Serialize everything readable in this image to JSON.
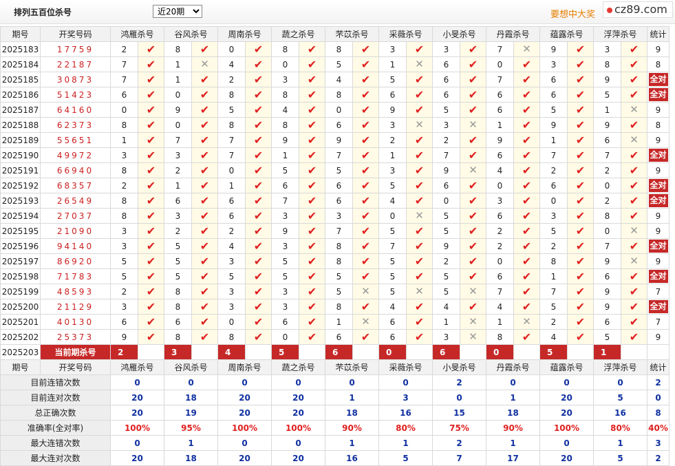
{
  "header": {
    "title": "排列五百位杀号",
    "period_select": "近20期",
    "promo_text": "要想中大奖",
    "logo_text": "cz89.com"
  },
  "columns": {
    "issue": "期号",
    "code": "开奖号码",
    "experts": [
      "鸿雁杀号",
      "谷风杀号",
      "周南杀号",
      "蔬之杀号",
      "芣苡杀号",
      "采薇杀号",
      "小旻杀号",
      "丹霞杀号",
      "蕴露杀号",
      "浮萍杀号"
    ],
    "stat": "统计"
  },
  "rows": [
    {
      "issue": "2025183",
      "code": "17759",
      "kill": [
        "2",
        "8",
        "0",
        "8",
        "8",
        "3",
        "3",
        "7",
        "9",
        "3"
      ],
      "ok": [
        1,
        1,
        1,
        1,
        1,
        1,
        1,
        0,
        1,
        1
      ],
      "count": "9"
    },
    {
      "issue": "2025184",
      "code": "22187",
      "kill": [
        "7",
        "1",
        "4",
        "0",
        "5",
        "1",
        "6",
        "0",
        "3",
        "8"
      ],
      "ok": [
        1,
        0,
        1,
        1,
        1,
        0,
        1,
        1,
        1,
        1
      ],
      "count": "8"
    },
    {
      "issue": "2025185",
      "code": "30873",
      "kill": [
        "7",
        "1",
        "2",
        "3",
        "4",
        "5",
        "6",
        "7",
        "6",
        "9"
      ],
      "ok": [
        1,
        1,
        1,
        1,
        1,
        1,
        1,
        1,
        1,
        1
      ],
      "count": "全对"
    },
    {
      "issue": "2025186",
      "code": "51423",
      "kill": [
        "6",
        "0",
        "8",
        "8",
        "8",
        "6",
        "6",
        "6",
        "6",
        "5"
      ],
      "ok": [
        1,
        1,
        1,
        1,
        1,
        1,
        1,
        1,
        1,
        1
      ],
      "count": "全对"
    },
    {
      "issue": "2025187",
      "code": "64160",
      "kill": [
        "0",
        "9",
        "5",
        "4",
        "0",
        "9",
        "5",
        "6",
        "5",
        "1"
      ],
      "ok": [
        1,
        1,
        1,
        1,
        1,
        1,
        1,
        1,
        1,
        0
      ],
      "count": "9"
    },
    {
      "issue": "2025188",
      "code": "62373",
      "kill": [
        "8",
        "0",
        "8",
        "8",
        "6",
        "3",
        "3",
        "1",
        "9",
        "9"
      ],
      "ok": [
        1,
        1,
        1,
        1,
        1,
        0,
        0,
        1,
        1,
        1
      ],
      "count": "8"
    },
    {
      "issue": "2025189",
      "code": "55651",
      "kill": [
        "1",
        "7",
        "7",
        "9",
        "9",
        "2",
        "2",
        "9",
        "1",
        "6"
      ],
      "ok": [
        1,
        1,
        1,
        1,
        1,
        1,
        1,
        1,
        1,
        0
      ],
      "count": "9"
    },
    {
      "issue": "2025190",
      "code": "49972",
      "kill": [
        "3",
        "3",
        "7",
        "1",
        "7",
        "1",
        "7",
        "6",
        "7",
        "7"
      ],
      "ok": [
        1,
        1,
        1,
        1,
        1,
        1,
        1,
        1,
        1,
        1
      ],
      "count": "全对"
    },
    {
      "issue": "2025191",
      "code": "66940",
      "kill": [
        "8",
        "2",
        "0",
        "5",
        "5",
        "3",
        "9",
        "4",
        "2",
        "2"
      ],
      "ok": [
        1,
        1,
        1,
        1,
        1,
        1,
        0,
        1,
        1,
        1
      ],
      "count": "9"
    },
    {
      "issue": "2025192",
      "code": "68357",
      "kill": [
        "2",
        "1",
        "1",
        "6",
        "6",
        "5",
        "6",
        "0",
        "6",
        "0"
      ],
      "ok": [
        1,
        1,
        1,
        1,
        1,
        1,
        1,
        1,
        1,
        1
      ],
      "count": "全对"
    },
    {
      "issue": "2025193",
      "code": "26549",
      "kill": [
        "8",
        "6",
        "6",
        "7",
        "6",
        "4",
        "0",
        "3",
        "0",
        "2"
      ],
      "ok": [
        1,
        1,
        1,
        1,
        1,
        1,
        1,
        1,
        1,
        1
      ],
      "count": "全对"
    },
    {
      "issue": "2025194",
      "code": "27037",
      "kill": [
        "8",
        "3",
        "6",
        "3",
        "3",
        "0",
        "5",
        "6",
        "3",
        "8"
      ],
      "ok": [
        1,
        1,
        1,
        1,
        1,
        0,
        1,
        1,
        1,
        1
      ],
      "count": "9"
    },
    {
      "issue": "2025195",
      "code": "21090",
      "kill": [
        "3",
        "2",
        "2",
        "9",
        "7",
        "5",
        "5",
        "2",
        "5",
        "0"
      ],
      "ok": [
        1,
        1,
        1,
        1,
        1,
        1,
        1,
        1,
        1,
        0
      ],
      "count": "9"
    },
    {
      "issue": "2025196",
      "code": "94140",
      "kill": [
        "3",
        "5",
        "4",
        "3",
        "8",
        "7",
        "9",
        "2",
        "2",
        "7"
      ],
      "ok": [
        1,
        1,
        1,
        1,
        1,
        1,
        1,
        1,
        1,
        1
      ],
      "count": "全对"
    },
    {
      "issue": "2025197",
      "code": "86920",
      "kill": [
        "5",
        "5",
        "3",
        "5",
        "8",
        "5",
        "2",
        "0",
        "8",
        "9"
      ],
      "ok": [
        1,
        1,
        1,
        1,
        1,
        1,
        1,
        1,
        1,
        0
      ],
      "count": "9"
    },
    {
      "issue": "2025198",
      "code": "71783",
      "kill": [
        "5",
        "5",
        "5",
        "5",
        "5",
        "5",
        "5",
        "6",
        "1",
        "6"
      ],
      "ok": [
        1,
        1,
        1,
        1,
        1,
        1,
        1,
        1,
        1,
        1
      ],
      "count": "全对"
    },
    {
      "issue": "2025199",
      "code": "48593",
      "kill": [
        "2",
        "8",
        "3",
        "3",
        "5",
        "5",
        "5",
        "7",
        "7",
        "9"
      ],
      "ok": [
        1,
        1,
        1,
        1,
        0,
        0,
        0,
        1,
        1,
        1
      ],
      "count": "7"
    },
    {
      "issue": "2025200",
      "code": "21129",
      "kill": [
        "3",
        "8",
        "3",
        "3",
        "8",
        "4",
        "4",
        "4",
        "5",
        "9"
      ],
      "ok": [
        1,
        1,
        1,
        1,
        1,
        1,
        1,
        1,
        1,
        1
      ],
      "count": "全对"
    },
    {
      "issue": "2025201",
      "code": "40130",
      "kill": [
        "6",
        "6",
        "0",
        "6",
        "1",
        "6",
        "1",
        "1",
        "2",
        "6"
      ],
      "ok": [
        1,
        1,
        1,
        1,
        0,
        1,
        0,
        0,
        1,
        1
      ],
      "count": "7"
    },
    {
      "issue": "2025202",
      "code": "25373",
      "kill": [
        "9",
        "8",
        "8",
        "0",
        "6",
        "6",
        "3",
        "8",
        "4",
        "5"
      ],
      "ok": [
        1,
        1,
        1,
        1,
        1,
        1,
        0,
        1,
        1,
        1
      ],
      "count": "9"
    }
  ],
  "current": {
    "issue": "2025203",
    "label": "当前期杀号",
    "kill": [
      "2",
      "3",
      "4",
      "5",
      "6",
      "0",
      "6",
      "0",
      "5",
      "1"
    ]
  },
  "stats": [
    {
      "label": "目前连错次数",
      "values": [
        "0",
        "0",
        "0",
        "0",
        "0",
        "0",
        "2",
        "0",
        "0",
        "0"
      ],
      "total": "2",
      "pct": false
    },
    {
      "label": "目前连对次数",
      "values": [
        "20",
        "18",
        "20",
        "20",
        "1",
        "3",
        "0",
        "1",
        "20",
        "5"
      ],
      "total": "0",
      "pct": false
    },
    {
      "label": "总正确次数",
      "values": [
        "20",
        "19",
        "20",
        "20",
        "18",
        "16",
        "15",
        "18",
        "20",
        "16"
      ],
      "total": "8",
      "pct": false
    },
    {
      "label": "准确率(全对率)",
      "values": [
        "100%",
        "95%",
        "100%",
        "100%",
        "90%",
        "80%",
        "75%",
        "90%",
        "100%",
        "80%"
      ],
      "total": "40%",
      "pct": true
    },
    {
      "label": "最大连错次数",
      "values": [
        "0",
        "1",
        "0",
        "0",
        "1",
        "1",
        "2",
        "1",
        "0",
        "1"
      ],
      "total": "3",
      "pct": false
    },
    {
      "label": "最大连对次数",
      "values": [
        "20",
        "18",
        "20",
        "20",
        "16",
        "5",
        "7",
        "17",
        "20",
        "5"
      ],
      "total": "2",
      "pct": false
    }
  ],
  "colors": {
    "accent_red": "#c62828",
    "check_red": "#e02020",
    "stat_blue": "#1030a0",
    "promo_orange": "#e67e00"
  }
}
